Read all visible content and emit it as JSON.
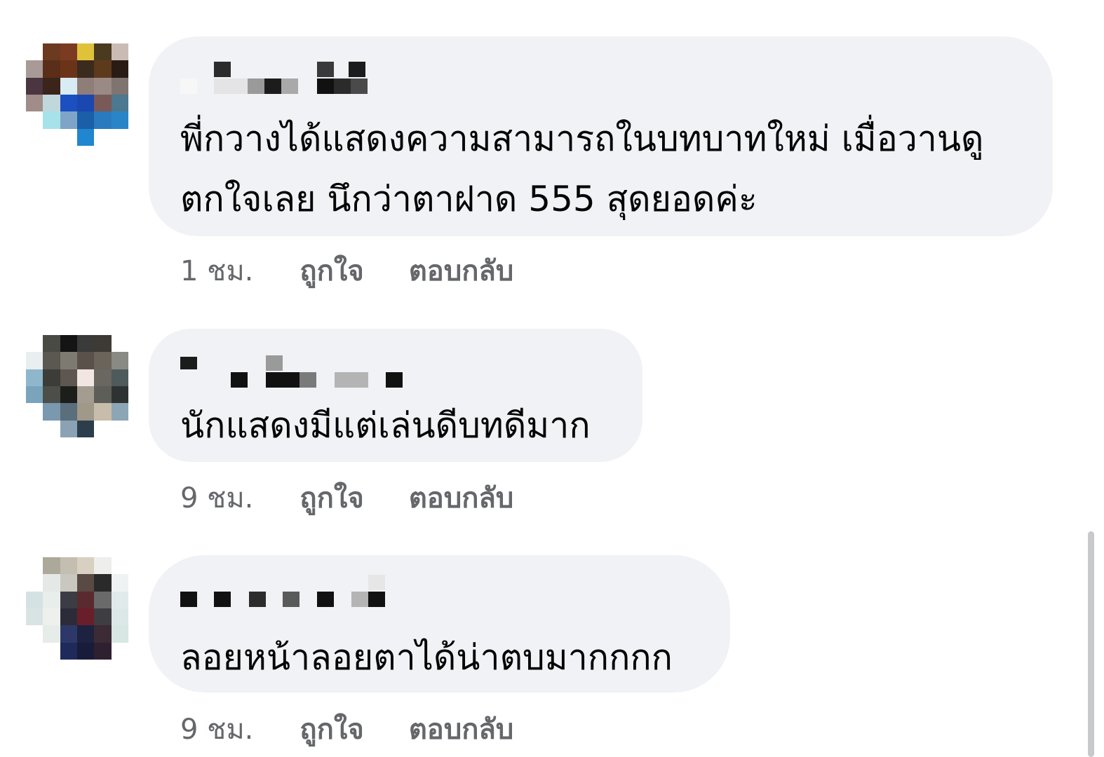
{
  "comments": [
    {
      "text_line1": "พี่กวางได้แสดงความสามารถในบทบาทใหม่ เมื่อวานดู",
      "text_line2": "ตกใจเลย นึกว่าตาฝาด 555 สุดยอดค่ะ",
      "time": "1 ชม.",
      "like_label": "ถูกใจ",
      "reply_label": "ตอบกลับ"
    },
    {
      "text_line1": "นักแสดงมีแต่เล่นดีบทดีมาก",
      "time": "9 ชม.",
      "like_label": "ถูกใจ",
      "reply_label": "ตอบกลับ"
    },
    {
      "text_line1": "ลอยหน้าลอยตาได้น่าตบมากกกก",
      "time": "9 ชม.",
      "like_label": "ถูกใจ",
      "reply_label": "ตอบกลับ"
    }
  ],
  "colors": {
    "bubble": "#f0f2f5",
    "text": "#050505",
    "secondary": "#65676b"
  }
}
